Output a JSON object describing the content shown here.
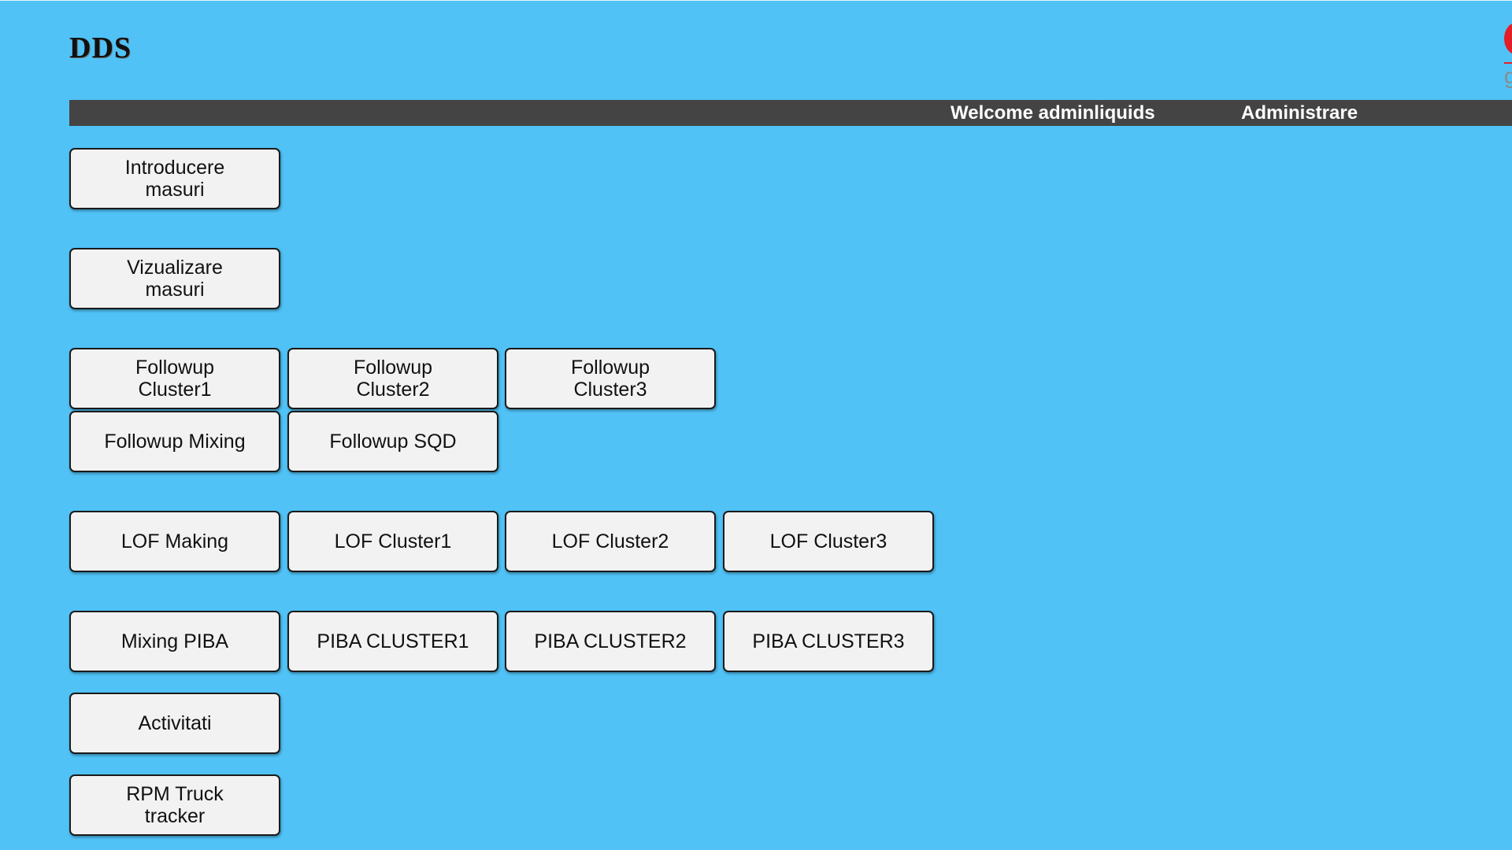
{
  "header": {
    "logo_text": "DDS",
    "corner_logo_letter": "g"
  },
  "navbar": {
    "welcome": "Welcome adminliquids",
    "admin_link": "Administrare"
  },
  "buttons": {
    "introducere_masuri": "Introducere\nmasuri",
    "vizualizare_masuri": "Vizualizare\nmasuri",
    "followup_cluster1": "Followup\nCluster1",
    "followup_cluster2": "Followup\nCluster2",
    "followup_cluster3": "Followup\nCluster3",
    "followup_mixing": "Followup Mixing",
    "followup_sqd": "Followup SQD",
    "lof_making": "LOF Making",
    "lof_cluster1": "LOF Cluster1",
    "lof_cluster2": "LOF Cluster2",
    "lof_cluster3": "LOF Cluster3",
    "mixing_piba": "Mixing PIBA",
    "piba_cluster1": "PIBA CLUSTER1",
    "piba_cluster2": "PIBA CLUSTER2",
    "piba_cluster3": "PIBA CLUSTER3",
    "activitati": "Activitati",
    "rpm_truck_tracker": "RPM Truck\ntracker"
  },
  "colors": {
    "page_background": "#50c2f6",
    "navbar_background": "#444444",
    "tile_background": "#f2f2f2",
    "brand_red": "#e41e26"
  }
}
